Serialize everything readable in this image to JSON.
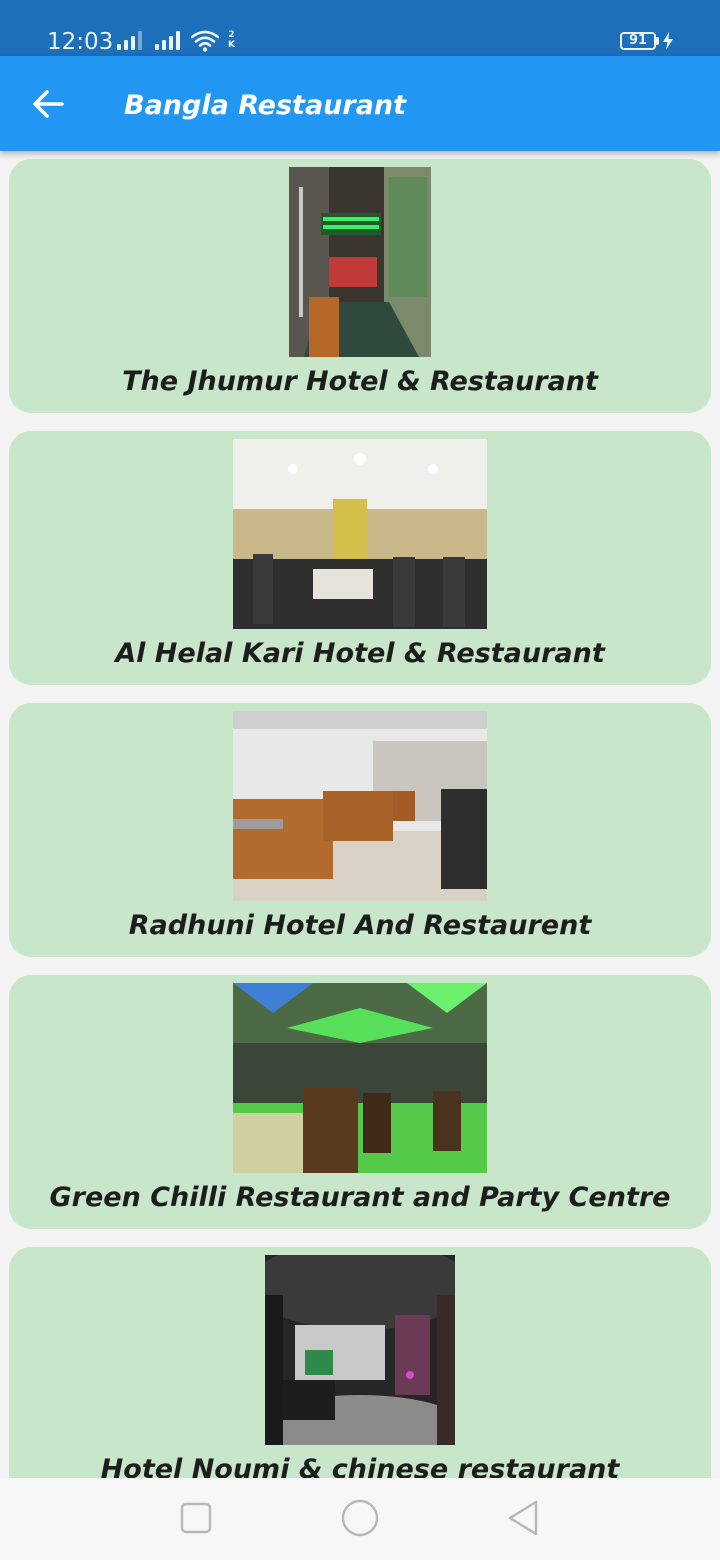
{
  "status_bar": {
    "time": "12:03",
    "network_tag": "2\nK",
    "battery_level": "91",
    "icons": [
      "signal-icon",
      "signal-icon",
      "wifi-icon",
      "battery-icon",
      "charging-icon"
    ]
  },
  "app_bar": {
    "back_icon": "arrow-left-icon",
    "title": "Bangla Restaurant",
    "color": "#2196f3"
  },
  "restaurants": [
    {
      "name": "The Jhumur Hotel & Restaurant",
      "image": "staircase entrance with green neon sign"
    },
    {
      "name": "Al Helal Kari Hotel & Restaurant",
      "image": "dining hall with white ceiling lights"
    },
    {
      "name": "Radhuni Hotel And Restaurent",
      "image": "brown leather booth seating"
    },
    {
      "name": "Green Chilli Restaurant and Party Centre",
      "image": "hall with green and blue ceiling lights"
    },
    {
      "name": "Hotel Noumi & chinese restaurant",
      "image": "dark panoramic dining room"
    }
  ],
  "card_color": "#c8e6c9",
  "nav_bar": {
    "icons": [
      "recent-apps-icon",
      "home-icon",
      "back-triangle-icon"
    ]
  }
}
